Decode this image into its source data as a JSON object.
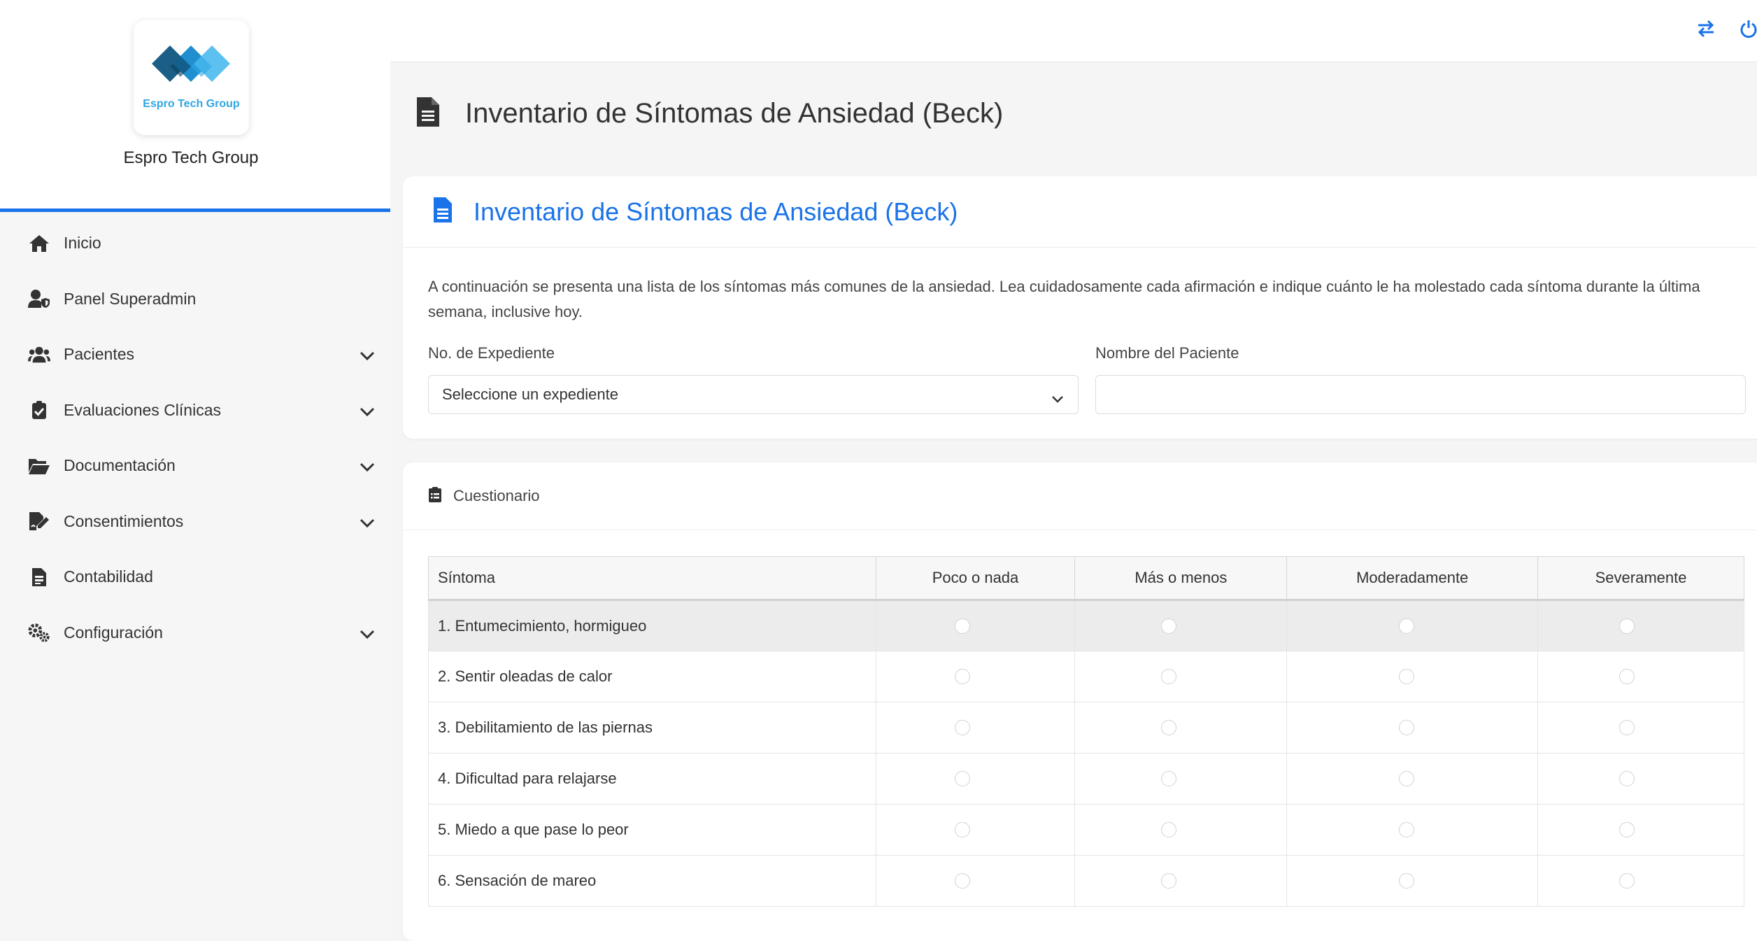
{
  "sidebar": {
    "logo_text": "Espro Tech Group",
    "brand_name": "Espro Tech Group",
    "items": [
      {
        "label": "Inicio",
        "icon": "home-icon",
        "expandable": false
      },
      {
        "label": "Panel Superadmin",
        "icon": "user-shield-icon",
        "expandable": false
      },
      {
        "label": "Pacientes",
        "icon": "users-icon",
        "expandable": true
      },
      {
        "label": "Evaluaciones Clínicas",
        "icon": "clipboard-check-icon",
        "expandable": true
      },
      {
        "label": "Documentación",
        "icon": "folder-open-icon",
        "expandable": true
      },
      {
        "label": "Consentimientos",
        "icon": "file-signature-icon",
        "expandable": true
      },
      {
        "label": "Contabilidad",
        "icon": "file-invoice-icon",
        "expandable": false
      },
      {
        "label": "Configuración",
        "icon": "cogs-icon",
        "expandable": true
      }
    ]
  },
  "topbar": {
    "icons": [
      "exchange-icon",
      "power-icon"
    ]
  },
  "page": {
    "title": "Inventario de Síntomas de Ansiedad (Beck)"
  },
  "form_card": {
    "title": "Inventario de Síntomas de Ansiedad (Beck)",
    "description": "A continuación se presenta una lista de los síntomas más comunes de la ansiedad. Lea cuidadosamente cada afirmación e indique cuánto le ha molestado cada síntoma durante la última semana, inclusive hoy.",
    "expediente_label": "No. de Expediente",
    "expediente_value": "Seleccione un expediente",
    "paciente_label": "Nombre del Paciente",
    "paciente_value": ""
  },
  "questionnaire": {
    "title": "Cuestionario",
    "headers": [
      "Síntoma",
      "Poco o nada",
      "Más o menos",
      "Moderadamente",
      "Severamente"
    ],
    "rows": [
      "1. Entumecimiento, hormigueo",
      "2. Sentir oleadas de calor",
      "3. Debilitamiento de las piernas",
      "4. Dificultad para relajarse",
      "5. Miedo a que pase lo peor",
      "6. Sensación de mareo"
    ]
  },
  "colors": {
    "accent": "#1a73e8",
    "sidebar_bg": "#f6f6f6",
    "highlight_row": "#ececec"
  }
}
